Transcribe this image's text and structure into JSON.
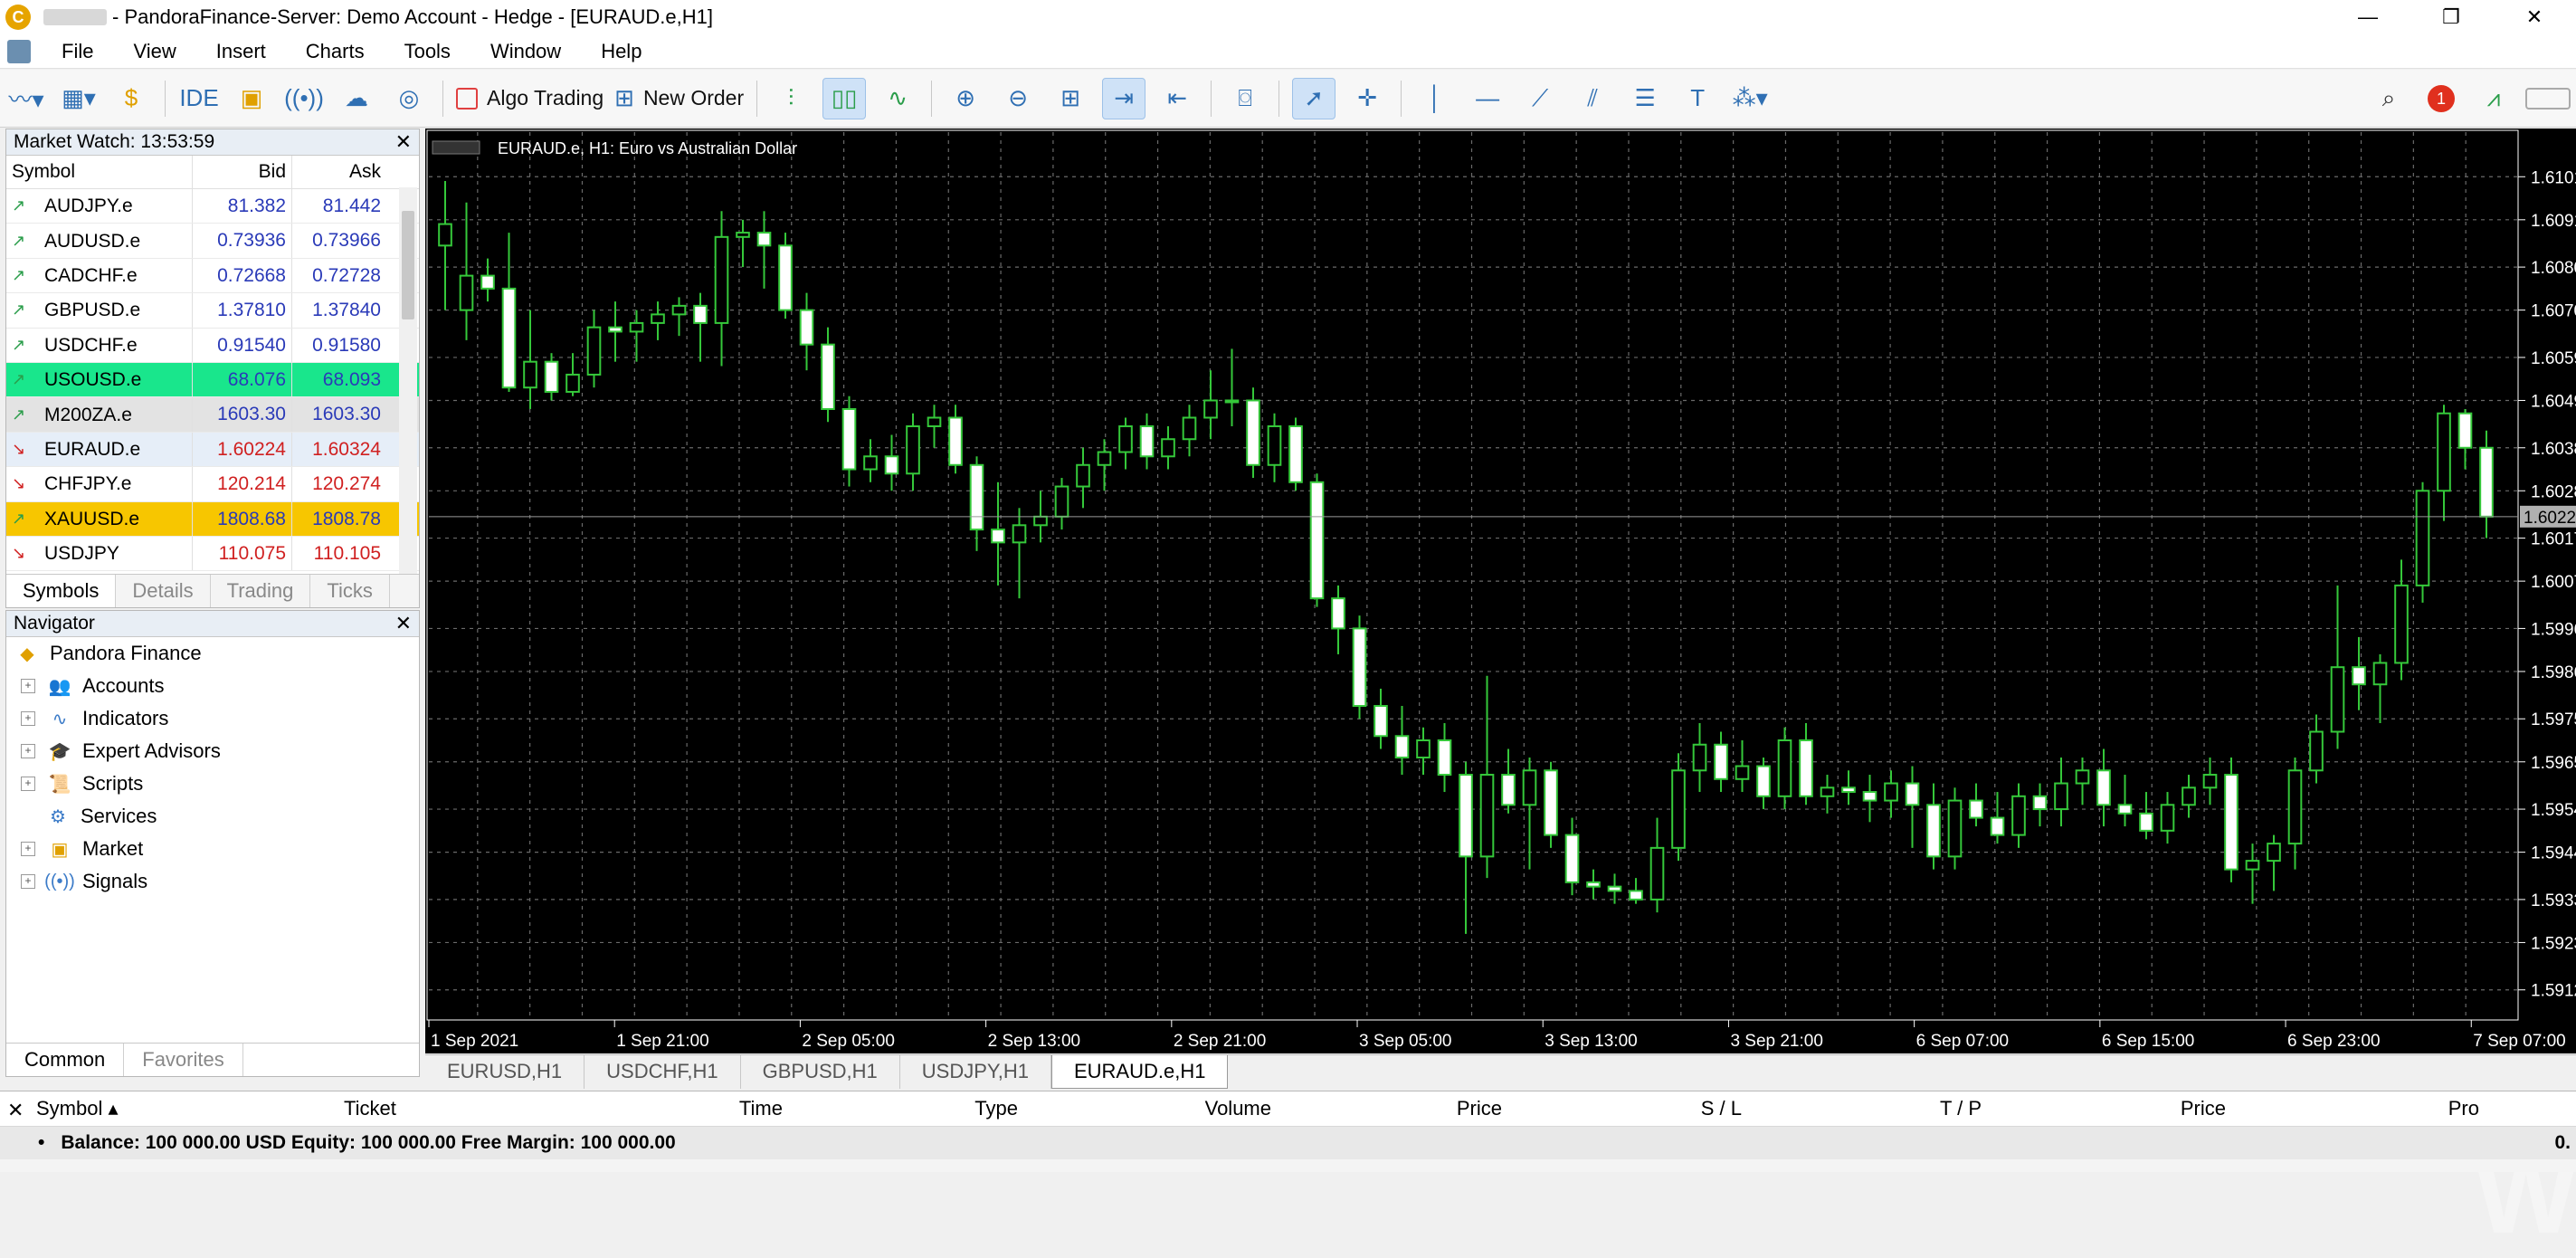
{
  "window": {
    "title": "- PandoraFinance-Server: Demo Account - Hedge - [EURAUD.e,H1]",
    "controls": [
      "—",
      "❐",
      "✕"
    ]
  },
  "menu": [
    "File",
    "View",
    "Insert",
    "Charts",
    "Tools",
    "Window",
    "Help"
  ],
  "toolbar": {
    "ide_label": "IDE",
    "algo_label": "Algo Trading",
    "new_order_label": "New Order",
    "notification_count": "1"
  },
  "market_watch": {
    "title": "Market Watch: 13:53:59",
    "columns": [
      "Symbol",
      "Bid",
      "Ask"
    ],
    "rows": [
      {
        "symbol": "AUDJPY.e",
        "bid": "81.382",
        "ask": "81.442",
        "dir": "up",
        "hl": ""
      },
      {
        "symbol": "AUDUSD.e",
        "bid": "0.73936",
        "ask": "0.73966",
        "dir": "up",
        "hl": ""
      },
      {
        "symbol": "CADCHF.e",
        "bid": "0.72668",
        "ask": "0.72728",
        "dir": "up",
        "hl": ""
      },
      {
        "symbol": "GBPUSD.e",
        "bid": "1.37810",
        "ask": "1.37840",
        "dir": "up",
        "hl": ""
      },
      {
        "symbol": "USDCHF.e",
        "bid": "0.91540",
        "ask": "0.91580",
        "dir": "up",
        "hl": ""
      },
      {
        "symbol": "USOUSD.e",
        "bid": "68.076",
        "ask": "68.093",
        "dir": "up",
        "hl": "#19e68c"
      },
      {
        "symbol": "M200ZA.e",
        "bid": "1603.30",
        "ask": "1603.30",
        "dir": "up",
        "hl": "#e3e3e3"
      },
      {
        "symbol": "EURAUD.e",
        "bid": "1.60224",
        "ask": "1.60324",
        "dir": "down",
        "hl": "#e6eef8"
      },
      {
        "symbol": "CHFJPY.e",
        "bid": "120.214",
        "ask": "120.274",
        "dir": "down",
        "hl": ""
      },
      {
        "symbol": "XAUUSD.e",
        "bid": "1808.68",
        "ask": "1808.78",
        "dir": "up",
        "hl": "#f7c600"
      },
      {
        "symbol": "USDJPY",
        "bid": "110.075",
        "ask": "110.105",
        "dir": "down",
        "hl": ""
      }
    ],
    "tabs": [
      "Symbols",
      "Details",
      "Trading",
      "Ticks"
    ]
  },
  "navigator": {
    "title": "Navigator",
    "root": "Pandora Finance",
    "items": [
      "Accounts",
      "Indicators",
      "Expert Advisors",
      "Scripts",
      "Services",
      "Market",
      "Signals"
    ],
    "tabs": [
      "Common",
      "Favorites"
    ]
  },
  "chart_data": {
    "type": "candlestick",
    "title": "EURAUD.e, H1:  Euro vs Australian Dollar",
    "x_labels": [
      "1 Sep 2021",
      "1 Sep 21:00",
      "2 Sep 05:00",
      "2 Sep 13:00",
      "2 Sep 21:00",
      "3 Sep 05:00",
      "3 Sep 13:00",
      "3 Sep 21:00",
      "6 Sep 07:00",
      "6 Sep 15:00",
      "6 Sep 23:00",
      "7 Sep 07:00"
    ],
    "y_ticks": [
      "1.6101",
      "1.6091",
      "1.6080",
      "1.6070",
      "1.6059",
      "1.6049",
      "1.6038",
      "1.6028",
      "1.6017",
      "1.6007",
      "1.5996",
      "1.5986",
      "1.5975",
      "1.5965",
      "1.5954",
      "1.5944",
      "1.5933",
      "1.5923",
      "1.5912"
    ],
    "current_price_label": "1.6022",
    "ylim": [
      1.5905,
      1.6108
    ],
    "candles": [
      [
        1.6085,
        1.61,
        1.607,
        1.609
      ],
      [
        1.607,
        1.6095,
        1.6063,
        1.6078
      ],
      [
        1.6078,
        1.6082,
        1.6072,
        1.6075
      ],
      [
        1.6075,
        1.6088,
        1.6051,
        1.6052
      ],
      [
        1.6052,
        1.607,
        1.6047,
        1.6058
      ],
      [
        1.6058,
        1.606,
        1.6049,
        1.6051
      ],
      [
        1.6051,
        1.606,
        1.605,
        1.6055
      ],
      [
        1.6055,
        1.607,
        1.6052,
        1.6066
      ],
      [
        1.6066,
        1.6072,
        1.6058,
        1.6065
      ],
      [
        1.6065,
        1.607,
        1.6058,
        1.6067
      ],
      [
        1.6067,
        1.6072,
        1.6063,
        1.6069
      ],
      [
        1.6069,
        1.6073,
        1.6064,
        1.6071
      ],
      [
        1.6071,
        1.6074,
        1.6058,
        1.6067
      ],
      [
        1.6067,
        1.6093,
        1.6057,
        1.6087
      ],
      [
        1.6087,
        1.6091,
        1.608,
        1.6088
      ],
      [
        1.6088,
        1.6093,
        1.6075,
        1.6085
      ],
      [
        1.6085,
        1.6088,
        1.6068,
        1.607
      ],
      [
        1.607,
        1.6074,
        1.6056,
        1.6062
      ],
      [
        1.6062,
        1.6066,
        1.6044,
        1.6047
      ],
      [
        1.6047,
        1.605,
        1.6029,
        1.6033
      ],
      [
        1.6033,
        1.604,
        1.603,
        1.6036
      ],
      [
        1.6036,
        1.6041,
        1.6028,
        1.6032
      ],
      [
        1.6032,
        1.6046,
        1.6028,
        1.6043
      ],
      [
        1.6043,
        1.6048,
        1.6038,
        1.6045
      ],
      [
        1.6045,
        1.6048,
        1.6032,
        1.6034
      ],
      [
        1.6034,
        1.6036,
        1.6014,
        1.6019
      ],
      [
        1.6019,
        1.603,
        1.6006,
        1.6016
      ],
      [
        1.6016,
        1.6024,
        1.6003,
        1.602
      ],
      [
        1.602,
        1.6028,
        1.6016,
        1.6022
      ],
      [
        1.6022,
        1.6031,
        1.6019,
        1.6029
      ],
      [
        1.6029,
        1.6038,
        1.6024,
        1.6034
      ],
      [
        1.6034,
        1.604,
        1.6028,
        1.6037
      ],
      [
        1.6037,
        1.6045,
        1.6033,
        1.6043
      ],
      [
        1.6043,
        1.6046,
        1.6033,
        1.6036
      ],
      [
        1.6036,
        1.6043,
        1.6033,
        1.604
      ],
      [
        1.604,
        1.6048,
        1.6036,
        1.6045
      ],
      [
        1.6045,
        1.6056,
        1.604,
        1.6049
      ],
      [
        1.6049,
        1.6061,
        1.6043,
        1.6049
      ],
      [
        1.6049,
        1.6052,
        1.6031,
        1.6034
      ],
      [
        1.6034,
        1.6046,
        1.603,
        1.6043
      ],
      [
        1.6043,
        1.6045,
        1.6028,
        1.603
      ],
      [
        1.603,
        1.6032,
        1.6001,
        1.6003
      ],
      [
        1.6003,
        1.6006,
        1.599,
        1.5996
      ],
      [
        1.5996,
        1.5999,
        1.5975,
        1.5978
      ],
      [
        1.5978,
        1.5982,
        1.5968,
        1.5971
      ],
      [
        1.5971,
        1.5978,
        1.5962,
        1.5966
      ],
      [
        1.5966,
        1.5973,
        1.5962,
        1.597
      ],
      [
        1.597,
        1.5974,
        1.5958,
        1.5962
      ],
      [
        1.5962,
        1.5965,
        1.5925,
        1.5943
      ],
      [
        1.5943,
        1.5985,
        1.5938,
        1.5962
      ],
      [
        1.5962,
        1.5968,
        1.5953,
        1.5955
      ],
      [
        1.5955,
        1.5966,
        1.594,
        1.5963
      ],
      [
        1.5963,
        1.5965,
        1.5945,
        1.5948
      ],
      [
        1.5948,
        1.5952,
        1.5934,
        1.5937
      ],
      [
        1.5937,
        1.594,
        1.5933,
        1.5936
      ],
      [
        1.5936,
        1.5939,
        1.5932,
        1.5935
      ],
      [
        1.5935,
        1.5938,
        1.5932,
        1.5933
      ],
      [
        1.5933,
        1.5952,
        1.593,
        1.5945
      ],
      [
        1.5945,
        1.5967,
        1.5942,
        1.5963
      ],
      [
        1.5963,
        1.5974,
        1.5958,
        1.5969
      ],
      [
        1.5969,
        1.5972,
        1.5958,
        1.5961
      ],
      [
        1.5961,
        1.597,
        1.5958,
        1.5964
      ],
      [
        1.5964,
        1.5966,
        1.5954,
        1.5957
      ],
      [
        1.5957,
        1.5973,
        1.5954,
        1.597
      ],
      [
        1.597,
        1.5974,
        1.5955,
        1.5957
      ],
      [
        1.5957,
        1.5962,
        1.5953,
        1.5959
      ],
      [
        1.5959,
        1.5963,
        1.5955,
        1.5958
      ],
      [
        1.5958,
        1.5962,
        1.5951,
        1.5956
      ],
      [
        1.5956,
        1.5963,
        1.5952,
        1.596
      ],
      [
        1.596,
        1.5964,
        1.5945,
        1.5955
      ],
      [
        1.5955,
        1.596,
        1.594,
        1.5943
      ],
      [
        1.5943,
        1.5959,
        1.594,
        1.5956
      ],
      [
        1.5956,
        1.596,
        1.595,
        1.5952
      ],
      [
        1.5952,
        1.5958,
        1.5946,
        1.5948
      ],
      [
        1.5948,
        1.596,
        1.5945,
        1.5957
      ],
      [
        1.5957,
        1.596,
        1.595,
        1.5954
      ],
      [
        1.5954,
        1.5966,
        1.595,
        1.596
      ],
      [
        1.596,
        1.5966,
        1.5955,
        1.5963
      ],
      [
        1.5963,
        1.5968,
        1.595,
        1.5955
      ],
      [
        1.5955,
        1.5962,
        1.595,
        1.5953
      ],
      [
        1.5953,
        1.5958,
        1.5947,
        1.5949
      ],
      [
        1.5949,
        1.5958,
        1.5946,
        1.5955
      ],
      [
        1.5955,
        1.5962,
        1.5952,
        1.5959
      ],
      [
        1.5959,
        1.5966,
        1.5955,
        1.5962
      ],
      [
        1.5962,
        1.5966,
        1.5937,
        1.594
      ],
      [
        1.594,
        1.5946,
        1.5932,
        1.5942
      ],
      [
        1.5942,
        1.5948,
        1.5935,
        1.5946
      ],
      [
        1.5946,
        1.5966,
        1.594,
        1.5963
      ],
      [
        1.5963,
        1.5976,
        1.596,
        1.5972
      ],
      [
        1.5972,
        1.6006,
        1.5968,
        1.5987
      ],
      [
        1.5987,
        1.5994,
        1.5977,
        1.5983
      ],
      [
        1.5983,
        1.599,
        1.5974,
        1.5988
      ],
      [
        1.5988,
        1.6012,
        1.5984,
        1.6006
      ],
      [
        1.6006,
        1.603,
        1.6002,
        1.6028
      ],
      [
        1.6028,
        1.6048,
        1.6021,
        1.6046
      ],
      [
        1.6046,
        1.6047,
        1.6033,
        1.6038
      ],
      [
        1.6038,
        1.6042,
        1.6017,
        1.6022
      ]
    ]
  },
  "chart_tabs": [
    "EURUSD,H1",
    "USDCHF,H1",
    "GBPUSD,H1",
    "USDJPY,H1",
    "EURAUD.e,H1"
  ],
  "terminal": {
    "columns": [
      "Symbol",
      "Ticket",
      "Time",
      "Type",
      "Volume",
      "Price",
      "S / L",
      "T / P",
      "Price",
      "Pro"
    ],
    "balance_text": "Balance: 100 000.00 USD  Equity: 100 000.00  Free Margin: 100 000.00",
    "profit_partial": "0."
  },
  "watermark": "WikiFX"
}
